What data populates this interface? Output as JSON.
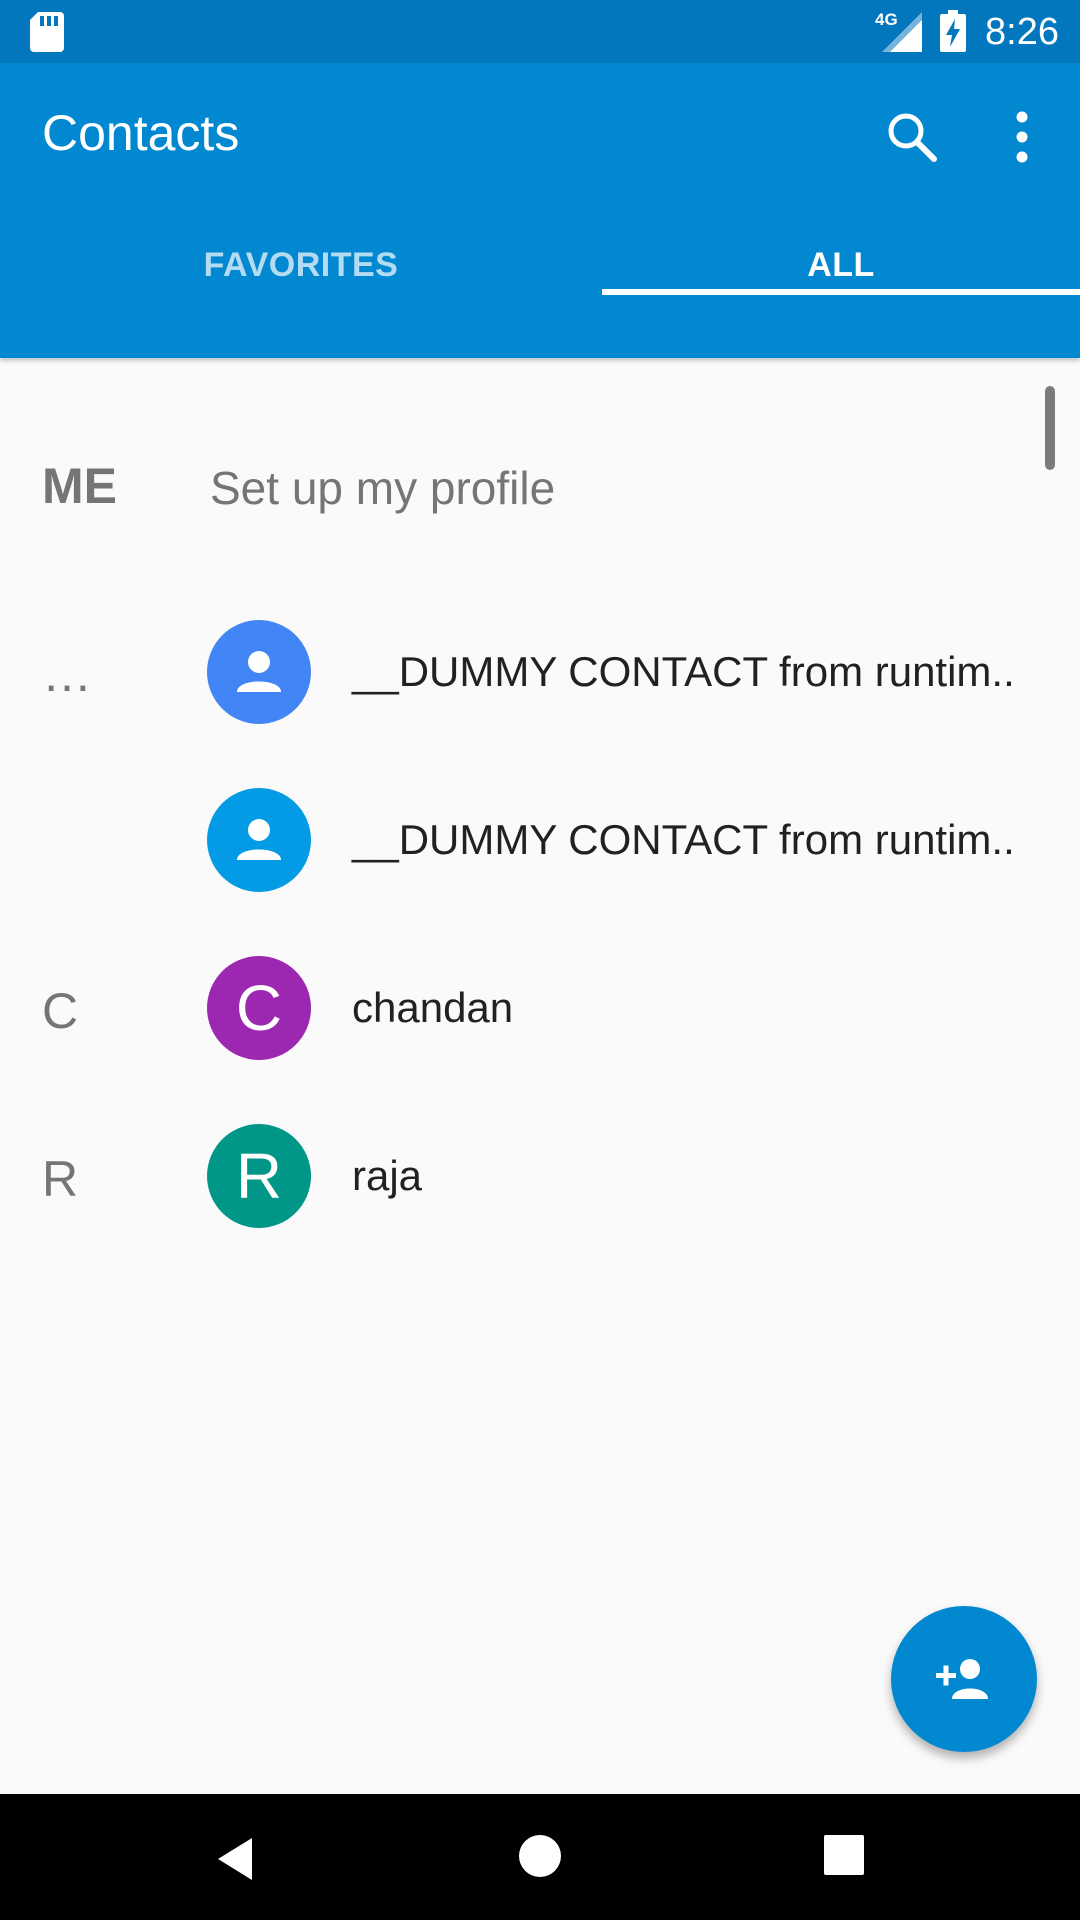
{
  "status_bar": {
    "network": "4G",
    "time": "8:26",
    "icons": [
      "sd-card-icon",
      "signal-icon",
      "battery-charging-icon"
    ]
  },
  "app_bar": {
    "title": "Contacts",
    "icons": [
      "search-icon",
      "more-vert-icon"
    ],
    "tabs": [
      {
        "label": "FAVORITES",
        "selected": false
      },
      {
        "label": "ALL",
        "selected": true
      }
    ]
  },
  "me_section": {
    "label": "ME",
    "text": "Set up my profile"
  },
  "contacts": [
    {
      "section": "…",
      "name": "__DUMMY CONTACT from runtim..",
      "avatar": "person-icon",
      "color": "#4285f4"
    },
    {
      "section": "",
      "name": "__DUMMY CONTACT from runtim..",
      "avatar": "person-icon",
      "color": "#039be5"
    },
    {
      "section": "C",
      "name": "chandan",
      "avatar": "C",
      "color": "#9c27b0"
    },
    {
      "section": "R",
      "name": "raja",
      "avatar": "R",
      "color": "#009688"
    }
  ],
  "fab": {
    "icon": "add-person-icon",
    "color": "#0288d1"
  },
  "nav_bar": {
    "icons": [
      "back-icon",
      "home-icon",
      "recents-icon"
    ]
  },
  "colors": {
    "status_bar": "#0277bd",
    "app_bar": "#0288d1",
    "background": "#fafafa"
  }
}
